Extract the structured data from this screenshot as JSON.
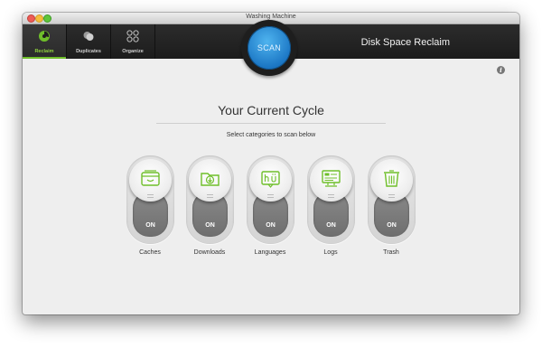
{
  "window": {
    "title": "Washing Machine"
  },
  "toolbar": {
    "tabs": [
      {
        "label": "Reclaim",
        "icon": "reclaim-icon",
        "active": true
      },
      {
        "label": "Duplicates",
        "icon": "duplicates-icon",
        "active": false
      },
      {
        "label": "Organize",
        "icon": "organize-icon",
        "active": false
      }
    ],
    "scan_label": "SCAN",
    "app_name": "Disk Space Reclaim",
    "accent_color": "#8fd23d",
    "scan_color": "#2a8fd8"
  },
  "main": {
    "heading": "Your Current Cycle",
    "subtitle": "Select categories to scan below",
    "categories": [
      {
        "label": "Caches",
        "state": "ON",
        "icon": "caches-icon"
      },
      {
        "label": "Downloads",
        "state": "ON",
        "icon": "downloads-icon"
      },
      {
        "label": "Languages",
        "state": "ON",
        "icon": "languages-icon"
      },
      {
        "label": "Logs",
        "state": "ON",
        "icon": "logs-icon"
      },
      {
        "label": "Trash",
        "state": "ON",
        "icon": "trash-icon"
      }
    ]
  }
}
